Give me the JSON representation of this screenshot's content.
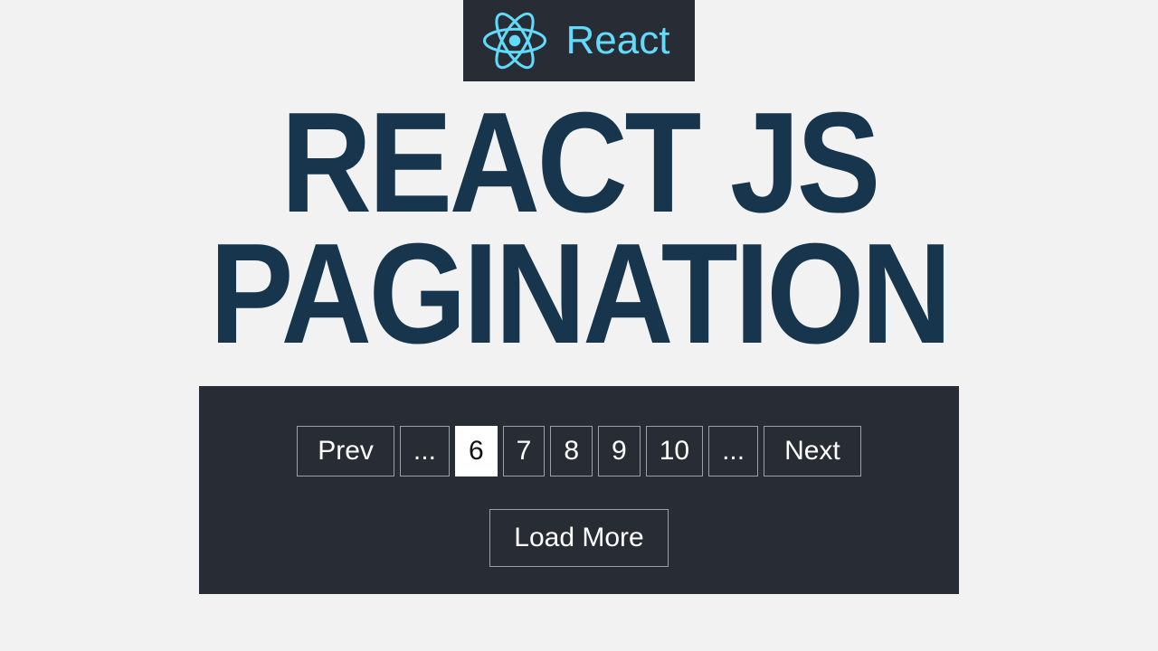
{
  "badge": {
    "label": "React"
  },
  "title": {
    "line1": "REACT JS",
    "line2": "PAGINATION"
  },
  "pagination": {
    "prev_label": "Prev",
    "next_label": "Next",
    "ellipsis": "...",
    "pages": [
      "6",
      "7",
      "8",
      "9",
      "10"
    ],
    "active_page": "6",
    "load_more_label": "Load More"
  },
  "colors": {
    "accent": "#61dafb",
    "panel_bg": "#282c34",
    "title": "#17364d",
    "page_bg": "#f2f2f2"
  }
}
